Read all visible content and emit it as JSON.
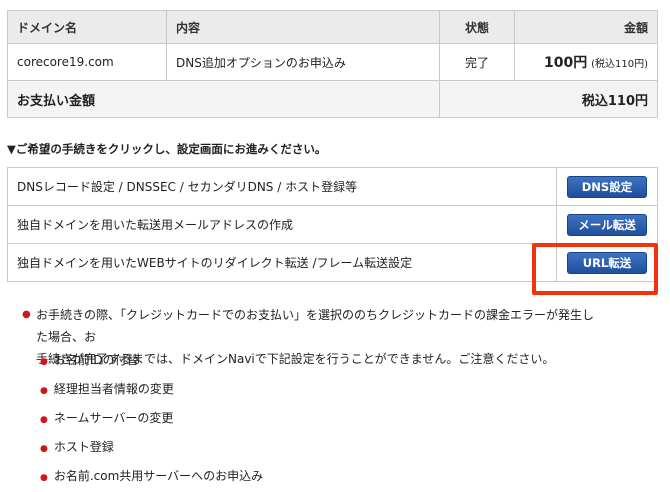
{
  "order": {
    "headers": {
      "domain": "ドメイン名",
      "content": "内容",
      "status": "状態",
      "amount": "金額"
    },
    "row": {
      "domain": "corecore19.com",
      "content": "DNS追加オプションのお申込み",
      "status": "完了",
      "amount_main": "100円",
      "amount_sub": "(税込110円)"
    },
    "total_label": "お支払い金額",
    "total_value": "税込110円"
  },
  "guide_text": "▼ご希望の手続きをクリックし、設定画面にお進みください。",
  "procedures": [
    {
      "label": "DNSレコード設定 / DNSSEC / セカンダリDNS / ホスト登録等",
      "button": "DNS設定"
    },
    {
      "label": "独自ドメインを用いた転送用メールアドレスの作成",
      "button": "メール転送"
    },
    {
      "label": "独自ドメインを用いたWEBサイトのリダイレクト転送 /フレーム転送設定",
      "button": "URL転送"
    }
  ],
  "notice": {
    "line1": "お手続きの際、「クレジットカードでのお支払い」を選択ののちクレジットカードの課金エラーが発生した場合、お",
    "line2": "手続きが完了するまでは、ドメインNaviで下記設定を行うことができません。ご注意ください。",
    "items": [
      "お名前IDの付替",
      "経理担当者情報の変更",
      "ネームサーバーの変更",
      "ホスト登録",
      "お名前.com共用サーバーへのお申込み"
    ]
  },
  "colors": {
    "highlight": "#f2330d",
    "button": "#2a5cad",
    "bullet": "#d1131a"
  }
}
